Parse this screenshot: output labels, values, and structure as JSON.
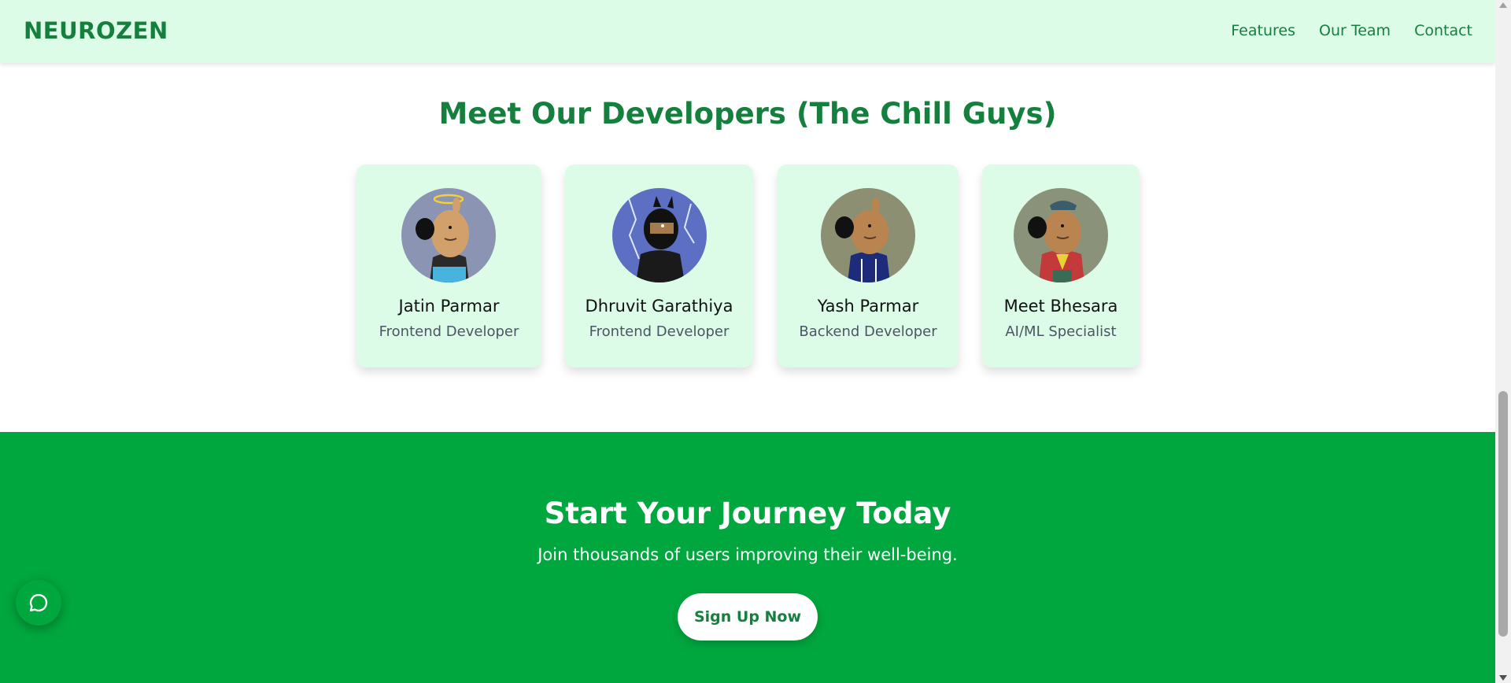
{
  "nav": {
    "brand": "NEUROZEN",
    "links": [
      "Features",
      "Our Team",
      "Contact"
    ]
  },
  "team": {
    "title": "Meet Our Developers (The Chill Guys)",
    "members": [
      {
        "name": "Jatin Parmar",
        "role": "Frontend Developer"
      },
      {
        "name": "Dhruvit Garathiya",
        "role": "Frontend Developer"
      },
      {
        "name": "Yash Parmar",
        "role": "Backend Developer"
      },
      {
        "name": "Meet Bhesara",
        "role": "AI/ML Specialist"
      }
    ]
  },
  "cta": {
    "title": "Start Your Journey Today",
    "subtitle": "Join thousands of users improving their well-being.",
    "button_label": "Sign Up Now"
  },
  "icons": {
    "chat": "chat-bubble-icon",
    "scroll_up": "triangle-up-icon",
    "scroll_down": "triangle-down-icon"
  },
  "colors": {
    "brand_green": "#15803d",
    "nav_bg": "#dcfce7",
    "cta_bg": "#00a63e",
    "card_bg": "#dcfce7"
  }
}
